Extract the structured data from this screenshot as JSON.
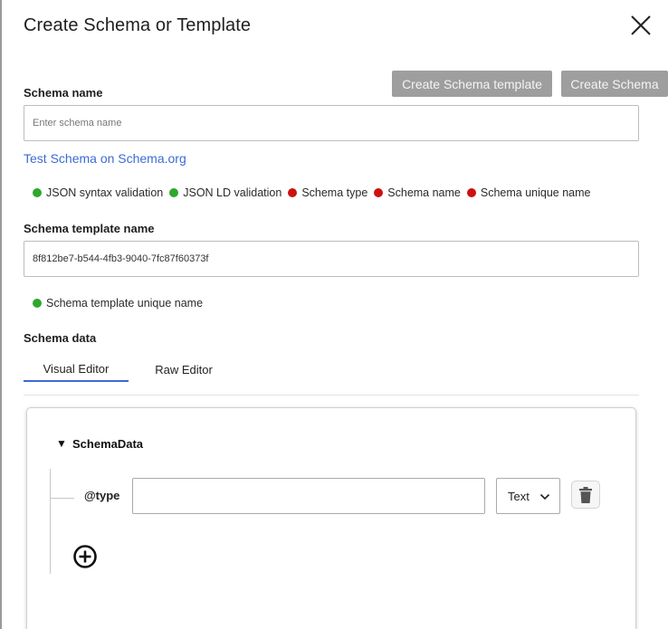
{
  "dialog": {
    "title": "Create Schema or Template"
  },
  "buttons": {
    "create_template": "Create Schema template",
    "create_schema": "Create Schema"
  },
  "schema_name": {
    "label": "Schema name",
    "placeholder": "Enter schema name",
    "value": ""
  },
  "test_link": "Test Schema on Schema.org",
  "validations": [
    {
      "label": "JSON syntax validation",
      "status": "pass",
      "color": "#2ea82e"
    },
    {
      "label": "JSON LD validation",
      "status": "pass",
      "color": "#2ea82e"
    },
    {
      "label": "Schema type",
      "status": "fail",
      "color": "#cc1111"
    },
    {
      "label": "Schema name",
      "status": "fail",
      "color": "#cc1111"
    },
    {
      "label": "Schema unique name",
      "status": "fail",
      "color": "#cc1111"
    }
  ],
  "template_name": {
    "label": "Schema template name",
    "value": "8f812be7-b544-4fb3-9040-7fc87f60373f"
  },
  "template_validations": [
    {
      "label": "Schema template unique name",
      "status": "pass",
      "color": "#2ea82e"
    }
  ],
  "schema_data": {
    "label": "Schema data",
    "tabs": [
      {
        "label": "Visual Editor",
        "active": true
      },
      {
        "label": "Raw Editor",
        "active": false
      }
    ]
  },
  "editor": {
    "root": "SchemaData",
    "properties": [
      {
        "key": "@type",
        "value": "",
        "type": "Text"
      }
    ]
  },
  "colors": {
    "accent": "#3b6bd6",
    "button_disabled": "#9e9e9e",
    "pass": "#2ea82e",
    "fail": "#cc1111"
  },
  "icons": {
    "close": "close-icon",
    "delete": "trash-icon",
    "add": "plus-circle-icon",
    "expand": "triangle-down-icon",
    "select": "chevron-down-icon"
  }
}
